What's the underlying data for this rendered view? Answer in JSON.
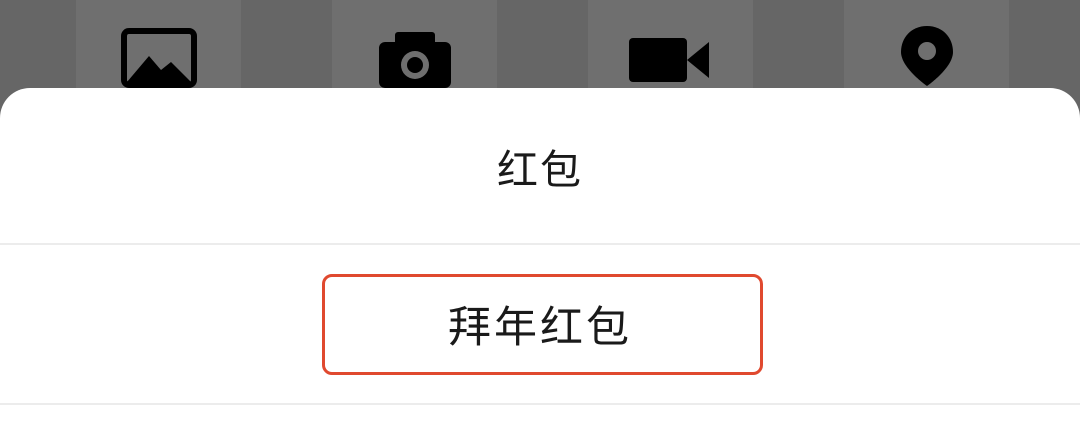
{
  "toolbar": {
    "icons": [
      "image-icon",
      "camera-icon",
      "video-icon",
      "location-pin-icon"
    ]
  },
  "sheet": {
    "title": "红包",
    "options": [
      {
        "label": "拜年红包"
      }
    ]
  },
  "colors": {
    "overlay": "#6a6a6a",
    "sheet_background": "#ffffff",
    "highlight_border": "#e0492f",
    "text": "#1a1a1a"
  }
}
